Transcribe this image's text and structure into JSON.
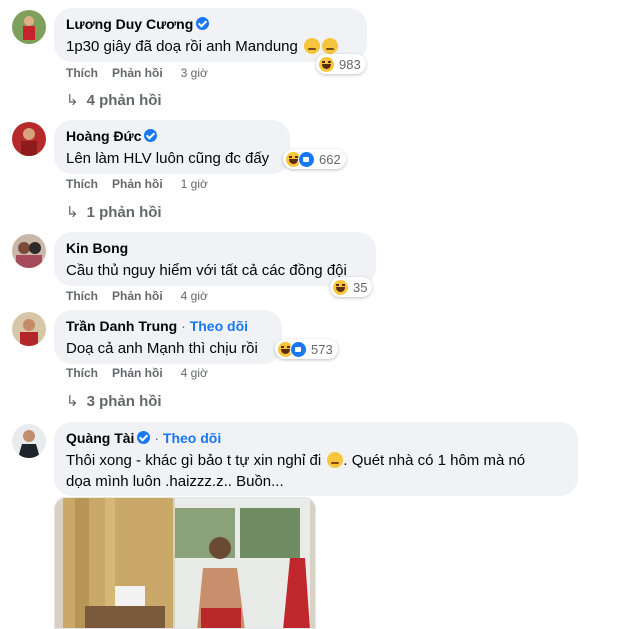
{
  "comments": [
    {
      "author": "Lương Duy Cương",
      "verified": true,
      "text": "1p30 giây đã doạ rồi anh Mandung",
      "reaction_count": "983",
      "like_label": "Thích",
      "reply_label": "Phản hồi",
      "time": "3 giờ",
      "replies_label": "4 phản hồi"
    },
    {
      "author": "Hoàng Đức",
      "verified": true,
      "text": "Lên làm HLV luôn cũng đc đấy",
      "reaction_count": "662",
      "like_label": "Thích",
      "reply_label": "Phản hồi",
      "time": "1 giờ",
      "replies_label": "1 phản hồi"
    },
    {
      "author": "Kin Bong",
      "verified": false,
      "text": "Cầu thủ nguy hiểm với tất cả các đồng đội",
      "reaction_count": "35",
      "like_label": "Thích",
      "reply_label": "Phản hồi",
      "time": "4 giờ"
    },
    {
      "author": "Trần Danh Trung",
      "verified": false,
      "follow_label": "Theo dõi",
      "text": "Doạ cả anh Mạnh thì chịu rồi",
      "reaction_count": "573",
      "like_label": "Thích",
      "reply_label": "Phản hồi",
      "time": "4 giờ",
      "replies_label": "3 phản hồi"
    },
    {
      "author": "Quàng Tài",
      "verified": true,
      "follow_label": "Theo dõi",
      "text_line1": "Thôi xong - khác gì bảo t tự xin nghỉ đi",
      "text_line1_tail": ". Quét nhà có 1 hôm mà nó",
      "text_line2": "dọa mình luôn .haizzz.z.. Buồn..."
    }
  ],
  "separator": "·",
  "icons": {
    "reply_arrow": "reply-arrow-icon",
    "verified": "verified-badge-icon",
    "haha": "haha-reaction-icon",
    "like": "like-reaction-icon"
  },
  "colors": {
    "bubble": "#f0f2f5",
    "link": "#1877f2",
    "meta": "#65676b"
  }
}
